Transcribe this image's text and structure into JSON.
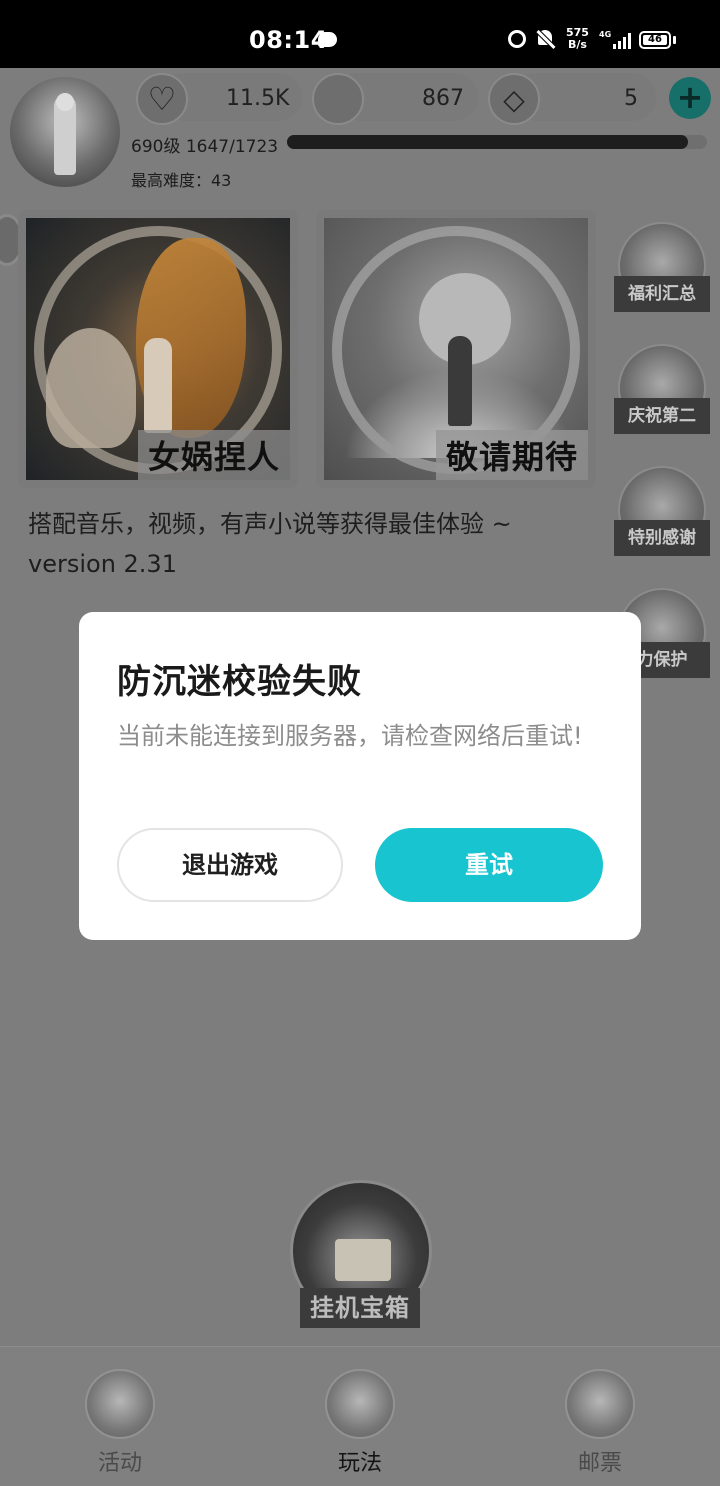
{
  "status_bar": {
    "time": "08:14",
    "net_speed_value": "575",
    "net_speed_unit": "B/s",
    "network": "4G",
    "battery": "46"
  },
  "profile": {
    "hearts": "11.5K",
    "coins": "867",
    "diamonds": "5",
    "level_text": "690级 1647/1723",
    "xp_current": 1647,
    "xp_max": 1723,
    "max_difficulty": "最高难度：43"
  },
  "cards": [
    {
      "label": "女娲捏人"
    },
    {
      "label": "敬请期待"
    }
  ],
  "tagline": "搭配音乐，视频，有声小说等获得最佳体验 ~",
  "version": "version 2.31",
  "side_nav": [
    {
      "label": "福利汇总"
    },
    {
      "label": "庆祝第二"
    },
    {
      "label": "特别感谢"
    },
    {
      "label": "力保护"
    }
  ],
  "dialog": {
    "title": "防沉迷校验失败",
    "message": "当前未能连接到服务器，请检查网络后重试!",
    "exit_label": "退出游戏",
    "retry_label": "重试"
  },
  "idle_chest": {
    "label": "挂机宝箱"
  },
  "bottom_nav": [
    {
      "label": "活动"
    },
    {
      "label": "玩法"
    },
    {
      "label": "邮票"
    }
  ],
  "colors": {
    "accent": "#17c4cf",
    "overlay": "#7d7d7d"
  }
}
